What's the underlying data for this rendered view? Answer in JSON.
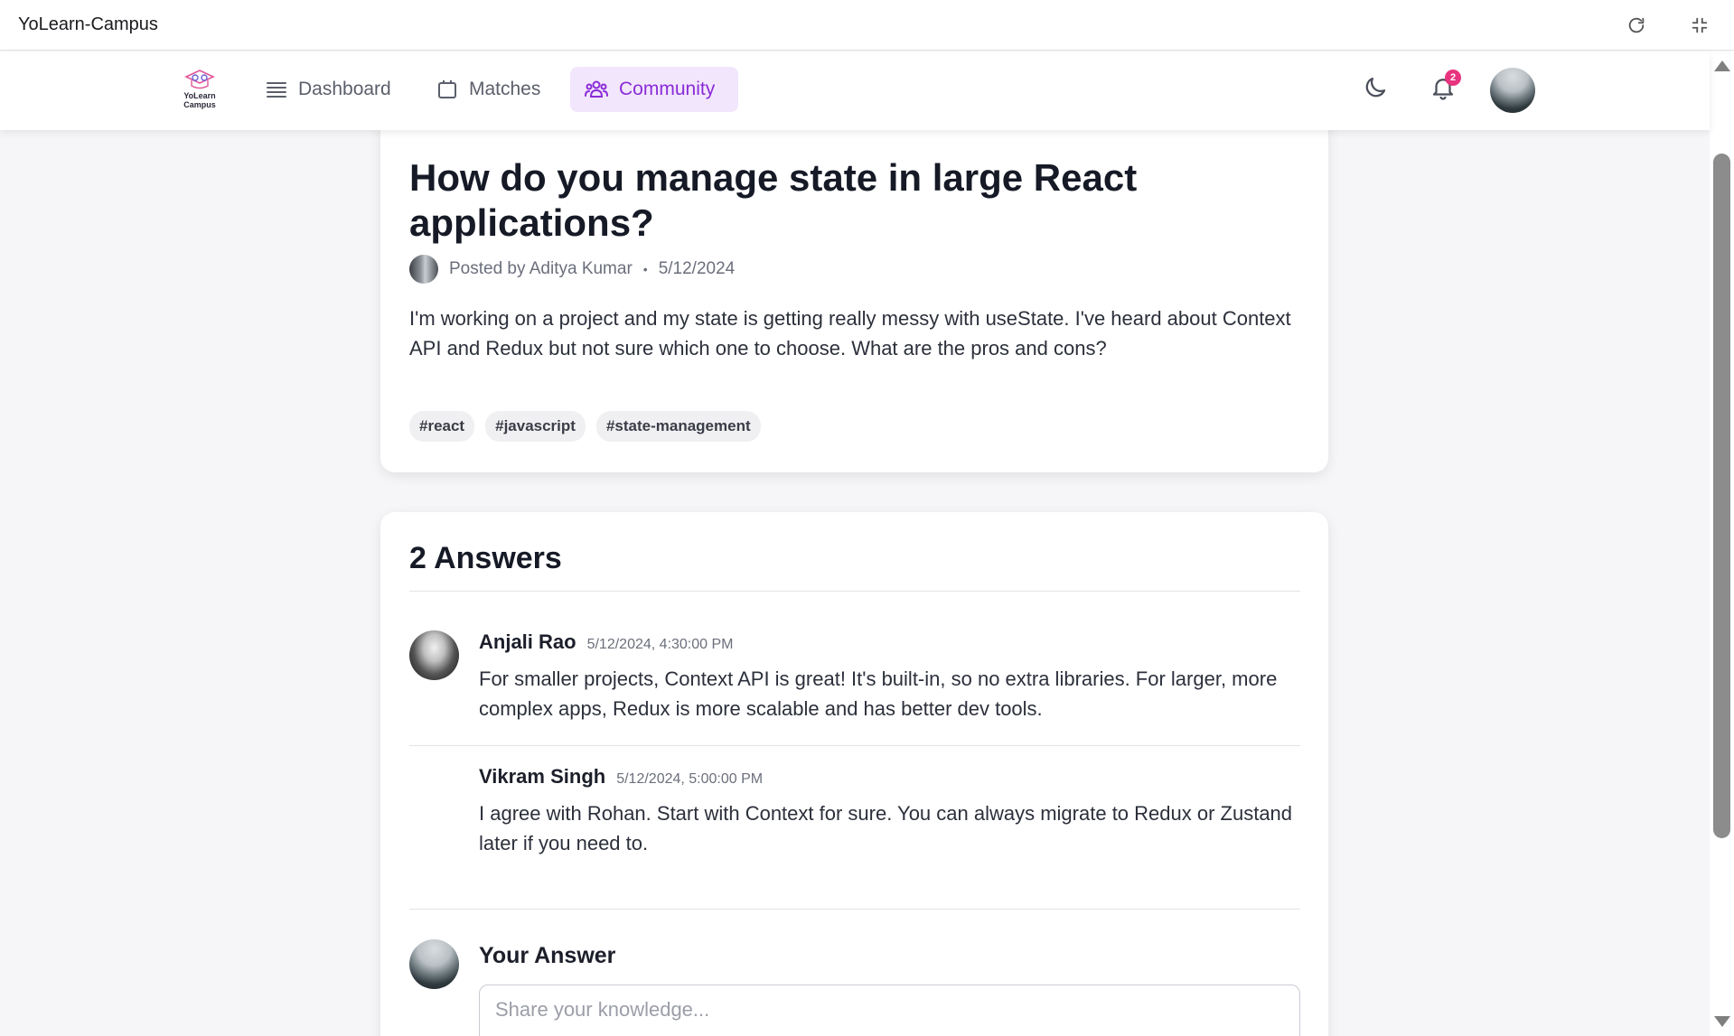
{
  "window": {
    "title": "YoLearn-Campus",
    "reload_icon": "reload-icon",
    "minimize_icon": "exit-fullscreen-icon"
  },
  "nav": {
    "logo_text_line1": "YoLearn",
    "logo_text_line2": "Campus",
    "items": [
      {
        "label": "Dashboard",
        "icon": "list-icon",
        "active": false
      },
      {
        "label": "Matches",
        "icon": "calendar-icon",
        "active": false
      },
      {
        "label": "Community",
        "icon": "users-icon",
        "active": true
      }
    ],
    "notification_count": "2",
    "active_color": "#8a2bd6",
    "active_bg": "#f2e6fd"
  },
  "question": {
    "title": "How do you manage state in large React applications?",
    "posted_by": "Posted by Aditya Kumar",
    "separator": "•",
    "date": "5/12/2024",
    "body": "I'm working on a project and my state is getting really messy with useState. I've heard about Context API and Redux but not sure which one to choose. What are the pros and cons?",
    "tags": [
      "#react",
      "#javascript",
      "#state-management"
    ]
  },
  "answers": {
    "heading": "2 Answers",
    "items": [
      {
        "author": "Anjali Rao",
        "timestamp": "5/12/2024, 4:30:00 PM",
        "text": "For smaller projects, Context API is great! It's built-in, so no extra libraries. For larger, more complex apps, Redux is more scalable and has better dev tools."
      },
      {
        "author": "Vikram Singh",
        "timestamp": "5/12/2024, 5:00:00 PM",
        "text": "I agree with Rohan. Start with Context for sure. You can always migrate to Redux or Zustand later if you need to."
      }
    ]
  },
  "your_answer": {
    "label": "Your Answer",
    "placeholder": "Share your knowledge...",
    "value": ""
  }
}
